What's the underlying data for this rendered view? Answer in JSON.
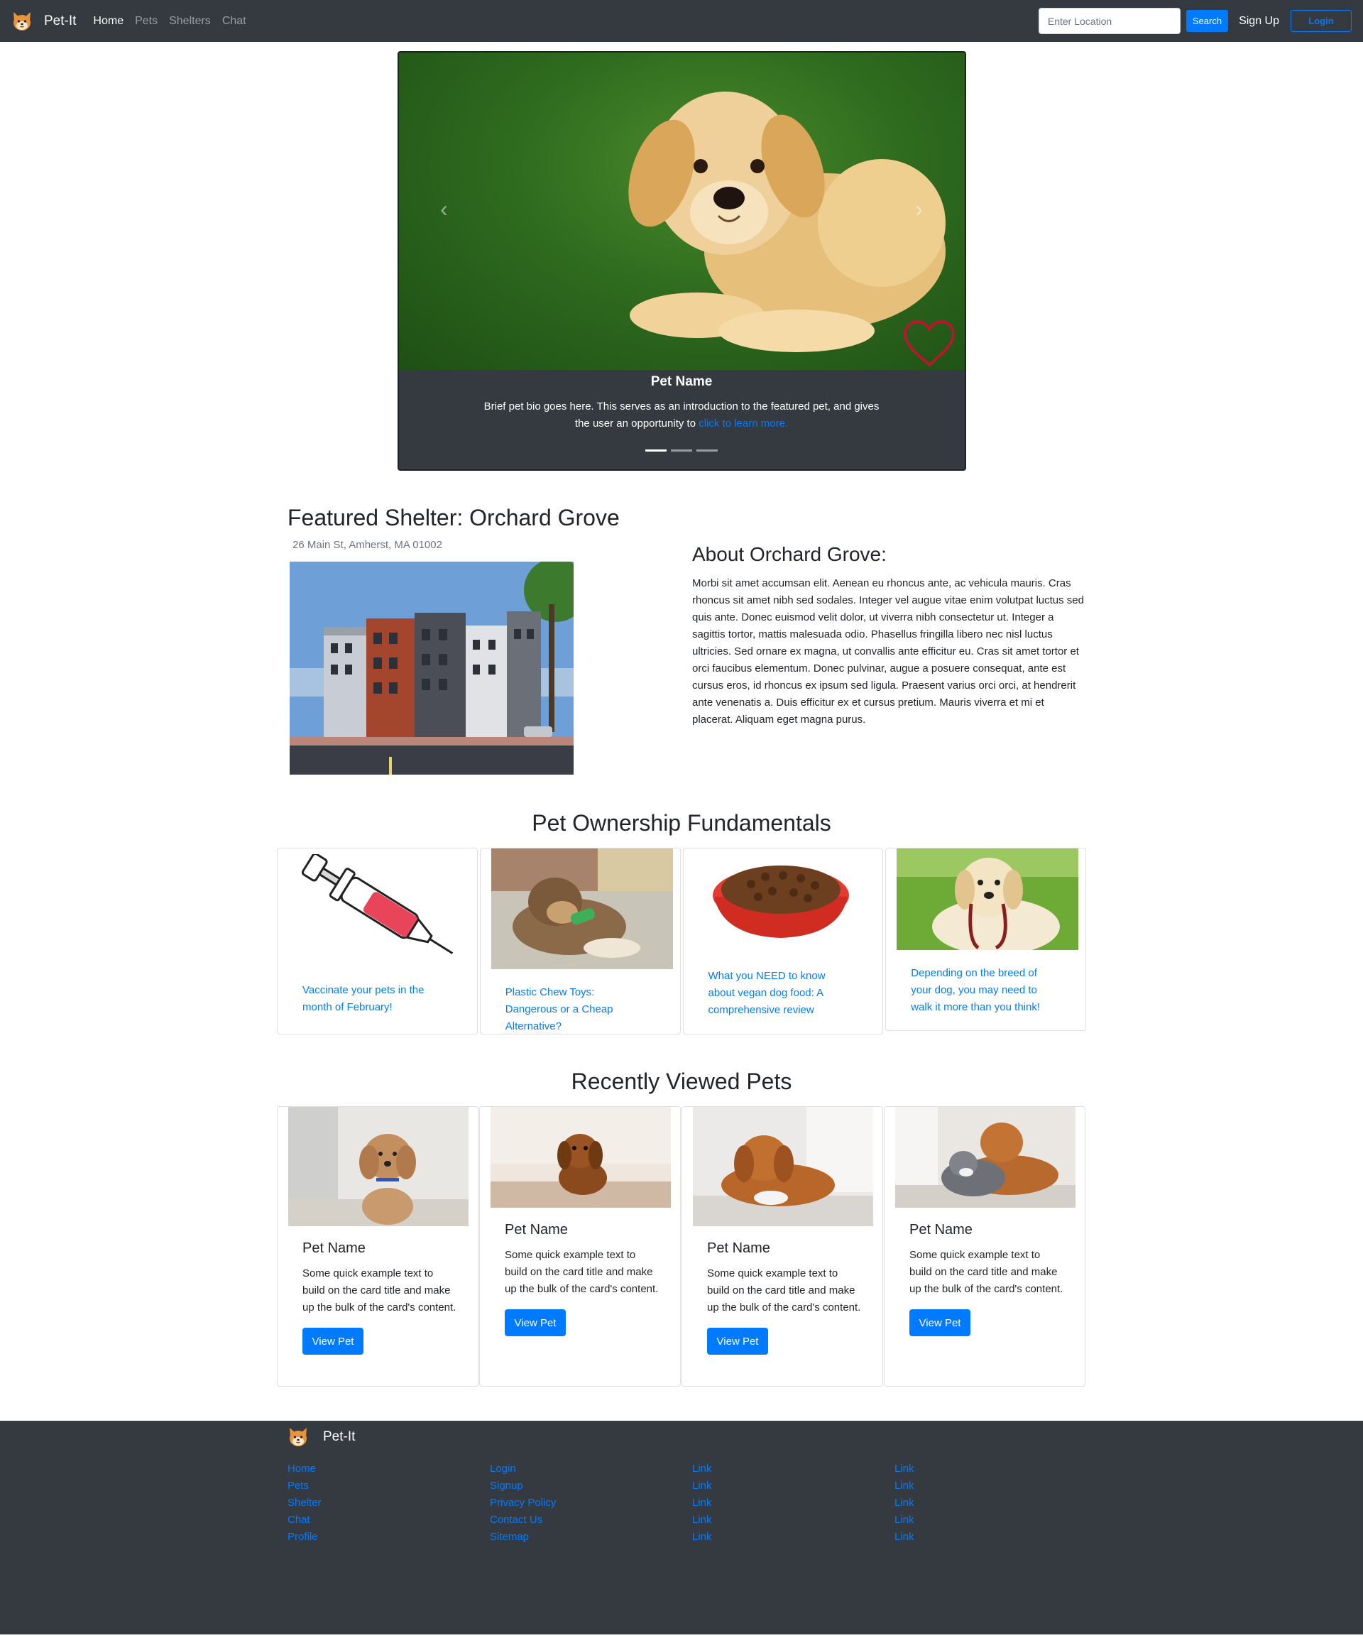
{
  "navbar": {
    "brand": "Pet-It",
    "links": [
      {
        "label": "Home",
        "active": true
      },
      {
        "label": "Pets",
        "active": false
      },
      {
        "label": "Shelters",
        "active": false
      },
      {
        "label": "Chat",
        "active": false
      }
    ],
    "location_placeholder": "Enter Location",
    "search_label": "Search",
    "signup_label": "Sign Up",
    "login_label": "Login"
  },
  "carousel": {
    "pet_name": "Pet Name",
    "bio": "Brief pet bio goes here. This serves as an introduction to the featured pet, and gives the user an opportunity to ",
    "bio_link": "click to learn more.",
    "slide_count": 3,
    "active_slide": 1
  },
  "featured_shelter": {
    "title": "Featured Shelter: Orchard Grove",
    "address": "26 Main St, Amherst, MA 01002",
    "about_title": "About Orchard Grove:",
    "about_text": "Morbi sit amet accumsan elit. Aenean eu rhoncus ante, ac vehicula mauris. Cras rhoncus sit amet nibh sed sodales. Integer vel augue vitae enim volutpat luctus sed quis ante. Donec euismod velit dolor, ut viverra nibh consectetur ut. Integer a sagittis tortor, mattis malesuada odio. Phasellus fringilla libero nec nisl luctus ultricies. Sed ornare ex magna, ut convallis ante efficitur eu. Cras sit amet tortor et orci faucibus elementum. Donec pulvinar, augue a posuere consequat, ante est cursus eros, id rhoncus ex ipsum sed ligula. Praesent varius orci orci, at hendrerit ante venenatis a. Duis efficitur ex et cursus pretium. Mauris viverra et mi et placerat. Aliquam eget magna purus."
  },
  "fundamentals": {
    "title": "Pet Ownership Fundamentals",
    "cards": [
      {
        "text": "Vaccinate your pets in the month of February!",
        "icon": "syringe-icon"
      },
      {
        "text": "Plastic Chew Toys: Dangerous or a Cheap Alternative?",
        "icon": "chew-toy-dog-photo"
      },
      {
        "text": "What you NEED to know about vegan dog food: A comprehensive review",
        "icon": "dog-food-bowl-photo"
      },
      {
        "text": "Depending on the breed of your dog, you may need to walk it more than you think!",
        "icon": "leash-dog-photo"
      }
    ]
  },
  "recent_pets": {
    "title": "Recently Viewed Pets",
    "cards": [
      {
        "name": "Pet Name",
        "text": "Some quick example text to build on the card title and make up the bulk of the card's content.",
        "button": "View Pet"
      },
      {
        "name": "Pet Name",
        "text": "Some quick example text to build on the card title and make up the bulk of the card's content.",
        "button": "View Pet"
      },
      {
        "name": "Pet Name",
        "text": "Some quick example text to build on the card title and make up the bulk of the card's content.",
        "button": "View Pet"
      },
      {
        "name": "Pet Name",
        "text": "Some quick example text to build on the card title and make up the bulk of the card's content.",
        "button": "View Pet"
      }
    ]
  },
  "footer": {
    "brand": "Pet-It",
    "columns": [
      [
        "Home",
        "Pets",
        "Shelter",
        "Chat",
        "Profile"
      ],
      [
        "Login",
        "Signup",
        "Privacy Policy",
        "Contact Us",
        "Sitemap"
      ],
      [
        "Link",
        "Link",
        "Link",
        "Link",
        "Link"
      ],
      [
        "Link",
        "Link",
        "Link",
        "Link",
        "Link"
      ]
    ]
  },
  "colors": {
    "navbar_bg": "#343a40",
    "accent": "#007bff",
    "heart": "#c8102e"
  }
}
